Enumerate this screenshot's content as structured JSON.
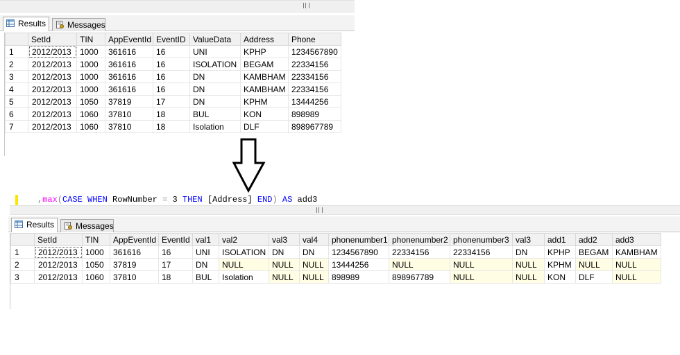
{
  "top_results": {
    "tabs": {
      "results": "Results",
      "messages": "Messages"
    },
    "columns": [
      "SetId",
      "TIN",
      "AppEventId",
      "EventID",
      "ValueData",
      "Address",
      "Phone"
    ],
    "rows": [
      {
        "n": "1",
        "cells": [
          "2012/2013",
          "1000",
          "361616",
          "16",
          "UNI",
          "KPHP",
          "1234567890"
        ]
      },
      {
        "n": "2",
        "cells": [
          "2012/2013",
          "1000",
          "361616",
          "16",
          "ISOLATION",
          "BEGAM",
          "22334156"
        ]
      },
      {
        "n": "3",
        "cells": [
          "2012/2013",
          "1000",
          "361616",
          "16",
          "DN",
          "KAMBHAM",
          "22334156"
        ]
      },
      {
        "n": "4",
        "cells": [
          "2012/2013",
          "1000",
          "361616",
          "16",
          "DN",
          "KAMBHAM",
          "22334156"
        ]
      },
      {
        "n": "5",
        "cells": [
          "2012/2013",
          "1050",
          "37819",
          "17",
          "DN",
          "KPHM",
          "13444256"
        ]
      },
      {
        "n": "6",
        "cells": [
          "2012/2013",
          "1060",
          "37810",
          "18",
          "BUL",
          "KON",
          "898989"
        ]
      },
      {
        "n": "7",
        "cells": [
          "2012/2013",
          "1060",
          "37810",
          "18",
          "Isolation",
          "DLF",
          "898967789"
        ]
      }
    ]
  },
  "code": {
    "comma": ",",
    "func": "max",
    "open_paren": "(",
    "kw_case": "CASE",
    "kw_when": "WHEN",
    "ident": "RowNumber",
    "op": "=",
    "num": "3",
    "kw_then": "THEN",
    "column": "[Address]",
    "kw_end": "END",
    "close_paren": ")",
    "kw_as": "AS",
    "alias": "add3"
  },
  "bottom_results": {
    "tabs": {
      "results": "Results",
      "messages": "Messages"
    },
    "columns": [
      "SetId",
      "TIN",
      "AppEventId",
      "EventId",
      "val1",
      "val2",
      "val3",
      "val4",
      "phonenumber1",
      "phonenumber2",
      "phonenumber3",
      "val3",
      "add1",
      "add2",
      "add3"
    ],
    "rows": [
      {
        "n": "1",
        "cells": [
          "2012/2013",
          "1000",
          "361616",
          "16",
          "UNI",
          "ISOLATION",
          "DN",
          "DN",
          "1234567890",
          "22334156",
          "22334156",
          "DN",
          "KPHP",
          "BEGAM",
          "KAMBHAM"
        ]
      },
      {
        "n": "2",
        "cells": [
          "2012/2013",
          "1050",
          "37819",
          "17",
          "DN",
          "NULL",
          "NULL",
          "NULL",
          "13444256",
          "NULL",
          "NULL",
          "NULL",
          "KPHM",
          "NULL",
          "NULL"
        ]
      },
      {
        "n": "3",
        "cells": [
          "2012/2013",
          "1060",
          "37810",
          "18",
          "BUL",
          "Isolation",
          "NULL",
          "NULL",
          "898989",
          "898967789",
          "NULL",
          "NULL",
          "KON",
          "DLF",
          "NULL"
        ]
      }
    ]
  },
  "colors": {
    "keyword": "#0000ff",
    "function": "#ff00ff",
    "null_fill": "#fffde3",
    "arrow": "#000000"
  }
}
